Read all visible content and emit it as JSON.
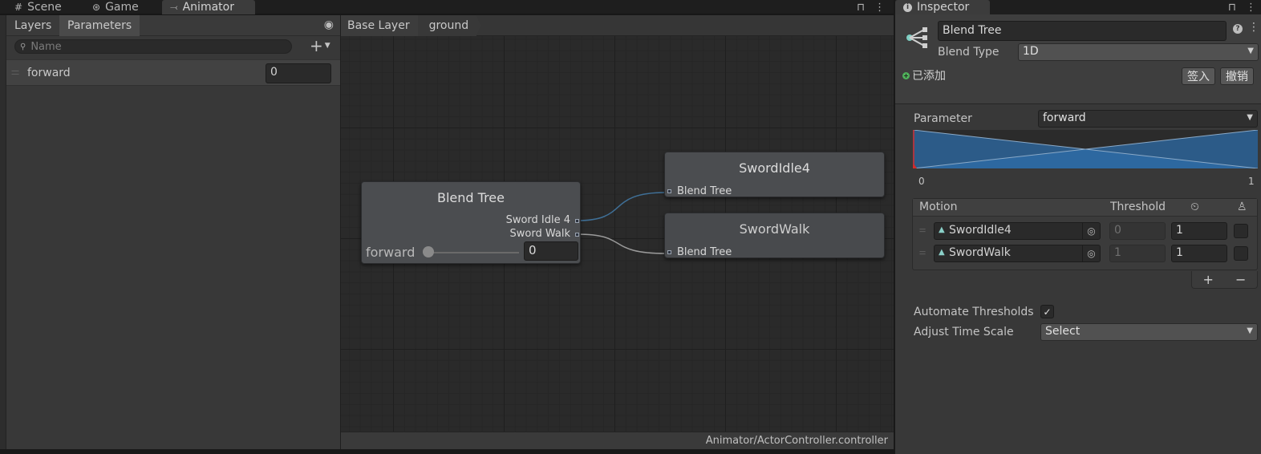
{
  "tabs": [
    {
      "label": "Scene",
      "icon": "grid-icon"
    },
    {
      "label": "Game",
      "icon": "gamepad-icon"
    },
    {
      "label": "Animator",
      "icon": "animator-icon"
    }
  ],
  "left_panel": {
    "tabs": [
      "Layers",
      "Parameters"
    ],
    "active_tab": "Parameters",
    "search_placeholder": "Name",
    "parameters": [
      {
        "name": "forward",
        "value": "0"
      }
    ]
  },
  "graph": {
    "breadcrumb": [
      "Base Layer",
      "ground"
    ],
    "blend_node": {
      "title": "Blend Tree",
      "outputs": [
        "Sword Idle 4",
        "Sword Walk"
      ],
      "param_label": "forward",
      "param_value": "0",
      "slider_value": 0
    },
    "states": [
      {
        "title": "SwordIdle4",
        "input_label": "Blend Tree"
      },
      {
        "title": "SwordWalk",
        "input_label": "Blend Tree"
      }
    ],
    "footer_path": "Animator/ActorController.controller"
  },
  "inspector": {
    "tab_label": "Inspector",
    "name": "Blend Tree",
    "blend_type_label": "Blend Type",
    "blend_type_value": "1D",
    "vcs_status": "已添加",
    "checkin_label": "签入",
    "revert_label": "撤销",
    "parameter_label": "Parameter",
    "parameter_value": "forward",
    "range_min": "0",
    "range_max": "1",
    "table_headers": {
      "motion": "Motion",
      "threshold": "Threshold"
    },
    "motions": [
      {
        "name": "SwordIdle4",
        "threshold": "0",
        "speed": "1"
      },
      {
        "name": "SwordWalk",
        "threshold": "1",
        "speed": "1"
      }
    ],
    "add_label": "+",
    "remove_label": "−",
    "automate_label": "Automate Thresholds",
    "automate_checked": true,
    "adjust_label": "Adjust Time Scale",
    "adjust_value": "Select"
  },
  "colors": {
    "blend_fill": "#2e6ca8",
    "wire_idle": "#3f6f96",
    "wire_walk": "#9a9a9a",
    "marker": "#d42a2a",
    "vcs_added": "#4fb25a"
  }
}
